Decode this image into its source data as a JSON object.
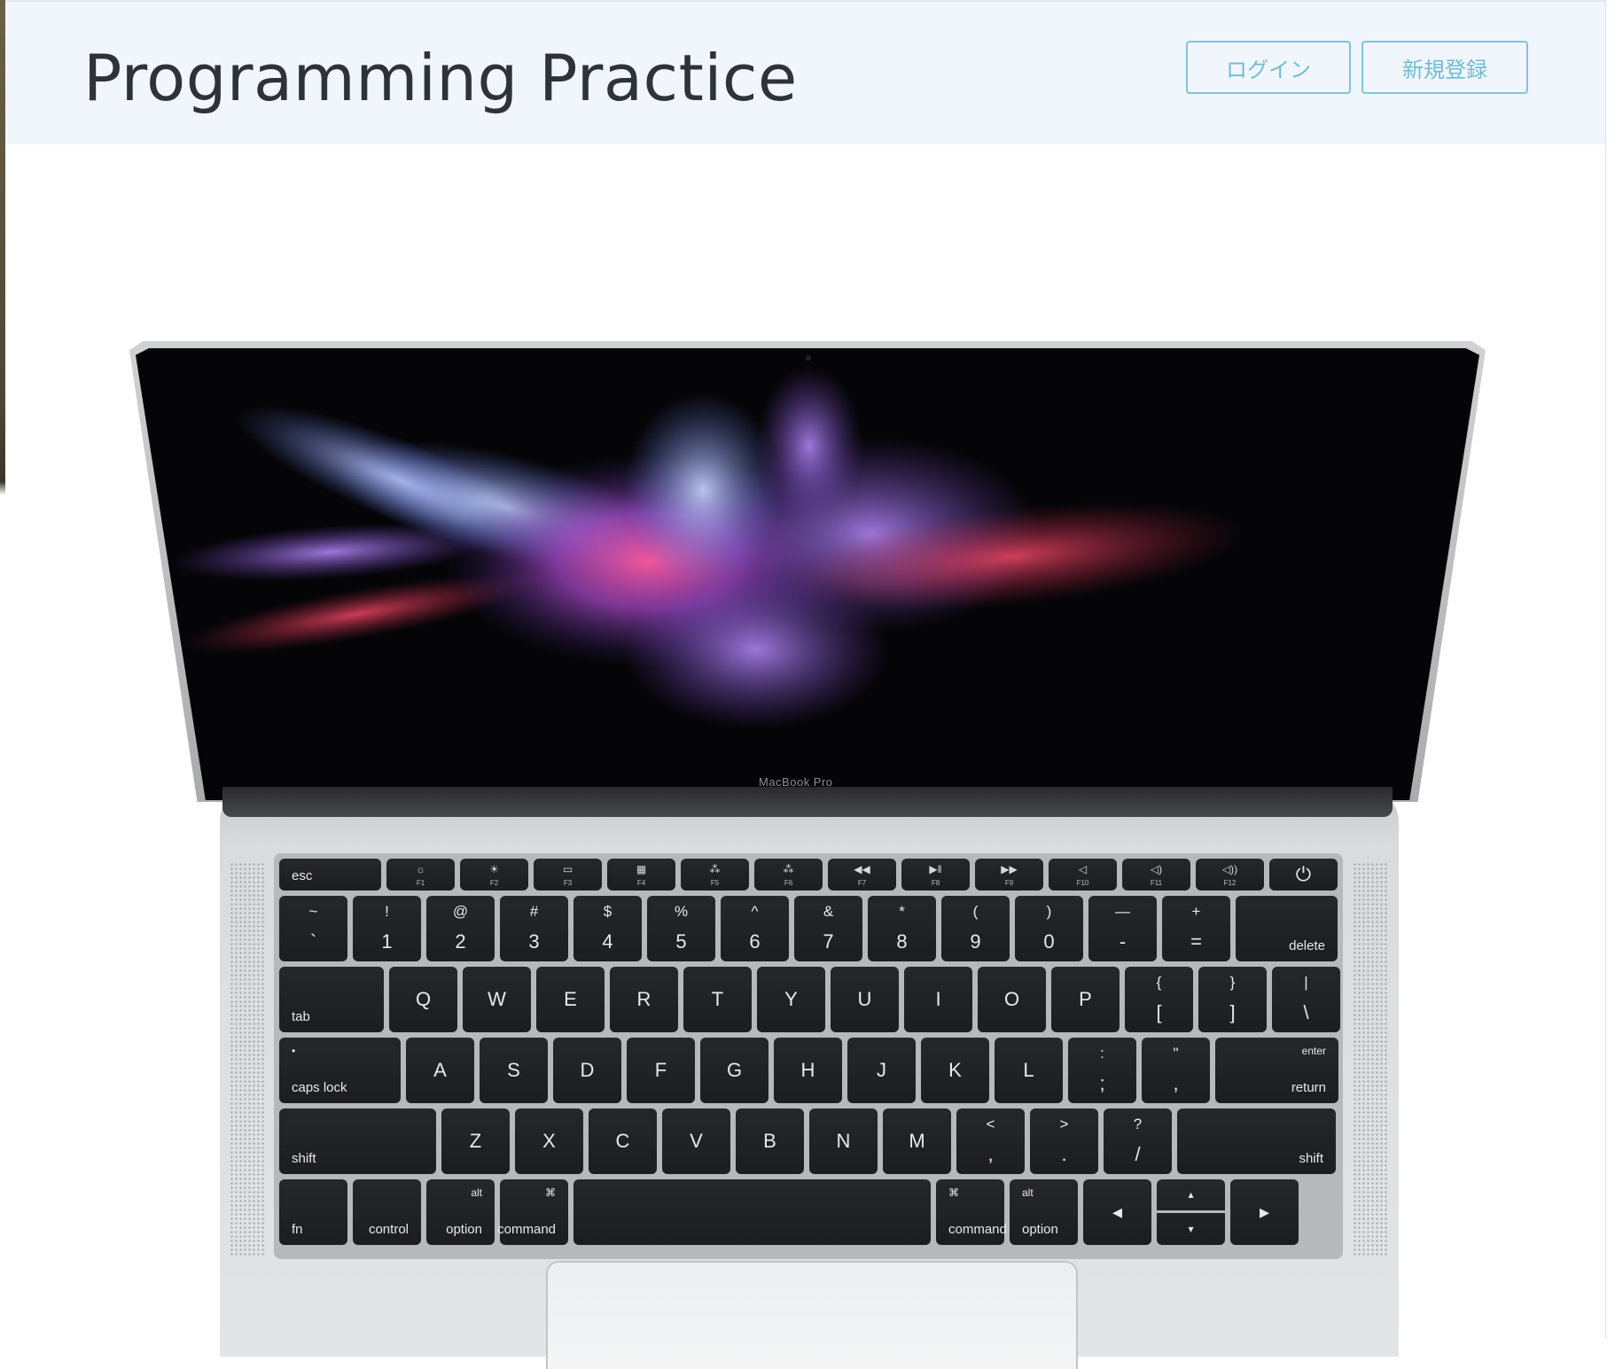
{
  "header": {
    "title": "Programming Practice",
    "login_label": "ログイン",
    "signup_label": "新規登録"
  },
  "colors": {
    "header_bg": "#f1f6fc",
    "button_accent": "#7cc6de",
    "title_text": "#2f3238"
  },
  "hero": {
    "image_name": "macbook-pro-icon",
    "brand_text": "MacBook Pro",
    "keyboard": {
      "fn_row": [
        {
          "label": "esc",
          "type": "text"
        },
        {
          "sub": "F1",
          "icon": "☼"
        },
        {
          "sub": "F2",
          "icon": "☀"
        },
        {
          "sub": "F3",
          "icon": "▭"
        },
        {
          "sub": "F4",
          "icon": "▦"
        },
        {
          "sub": "F5",
          "icon": "⁂"
        },
        {
          "sub": "F6",
          "icon": "⁂"
        },
        {
          "sub": "F7",
          "icon": "◀◀"
        },
        {
          "sub": "F8",
          "icon": "▶‖"
        },
        {
          "sub": "F9",
          "icon": "▶▶"
        },
        {
          "sub": "F10",
          "icon": "◁"
        },
        {
          "sub": "F11",
          "icon": "◁)"
        },
        {
          "sub": "F12",
          "icon": "◁))"
        },
        {
          "label": "⏻",
          "type": "power"
        }
      ],
      "num_row": [
        {
          "top": "~",
          "main": "`"
        },
        {
          "top": "!",
          "main": "1"
        },
        {
          "top": "@",
          "main": "2"
        },
        {
          "top": "#",
          "main": "3"
        },
        {
          "top": "$",
          "main": "4"
        },
        {
          "top": "%",
          "main": "5"
        },
        {
          "top": "^",
          "main": "6"
        },
        {
          "top": "&",
          "main": "7"
        },
        {
          "top": "*",
          "main": "8"
        },
        {
          "top": "(",
          "main": "9"
        },
        {
          "top": ")",
          "main": "0"
        },
        {
          "top": "—",
          "main": "-"
        },
        {
          "top": "+",
          "main": "="
        },
        {
          "br": "delete"
        }
      ],
      "qwerty_row": [
        {
          "bl": "tab"
        },
        {
          "c": "Q"
        },
        {
          "c": "W"
        },
        {
          "c": "E"
        },
        {
          "c": "R"
        },
        {
          "c": "T"
        },
        {
          "c": "Y"
        },
        {
          "c": "U"
        },
        {
          "c": "I"
        },
        {
          "c": "O"
        },
        {
          "c": "P"
        },
        {
          "top": "{",
          "main": "["
        },
        {
          "top": "}",
          "main": "]"
        },
        {
          "top": "|",
          "main": "\\"
        }
      ],
      "home_row": [
        {
          "bl": "caps lock",
          "tl": "•"
        },
        {
          "c": "A"
        },
        {
          "c": "S"
        },
        {
          "c": "D"
        },
        {
          "c": "F"
        },
        {
          "c": "G"
        },
        {
          "c": "H"
        },
        {
          "c": "J"
        },
        {
          "c": "K"
        },
        {
          "c": "L"
        },
        {
          "top": ":",
          "main": ";"
        },
        {
          "top": "\"",
          "main": ","
        },
        {
          "br": "return",
          "tr": "enter"
        }
      ],
      "shift_row": [
        {
          "bl": "shift"
        },
        {
          "c": "Z"
        },
        {
          "c": "X"
        },
        {
          "c": "C"
        },
        {
          "c": "V"
        },
        {
          "c": "B"
        },
        {
          "c": "N"
        },
        {
          "c": "M"
        },
        {
          "top": "<",
          "main": ","
        },
        {
          "top": ">",
          "main": "."
        },
        {
          "top": "?",
          "main": "/"
        },
        {
          "br": "shift"
        }
      ],
      "bottom_row": [
        {
          "bl": "fn"
        },
        {
          "br": "control"
        },
        {
          "br": "option",
          "tr": "alt"
        },
        {
          "br": "command",
          "tr": "⌘"
        },
        {
          "space": ""
        },
        {
          "bl": "command",
          "tl": "⌘"
        },
        {
          "bl": "option",
          "tl": "alt"
        },
        {
          "c": "◂"
        },
        {
          "arrows": "▴|▾"
        },
        {
          "c": "▸"
        }
      ]
    }
  }
}
